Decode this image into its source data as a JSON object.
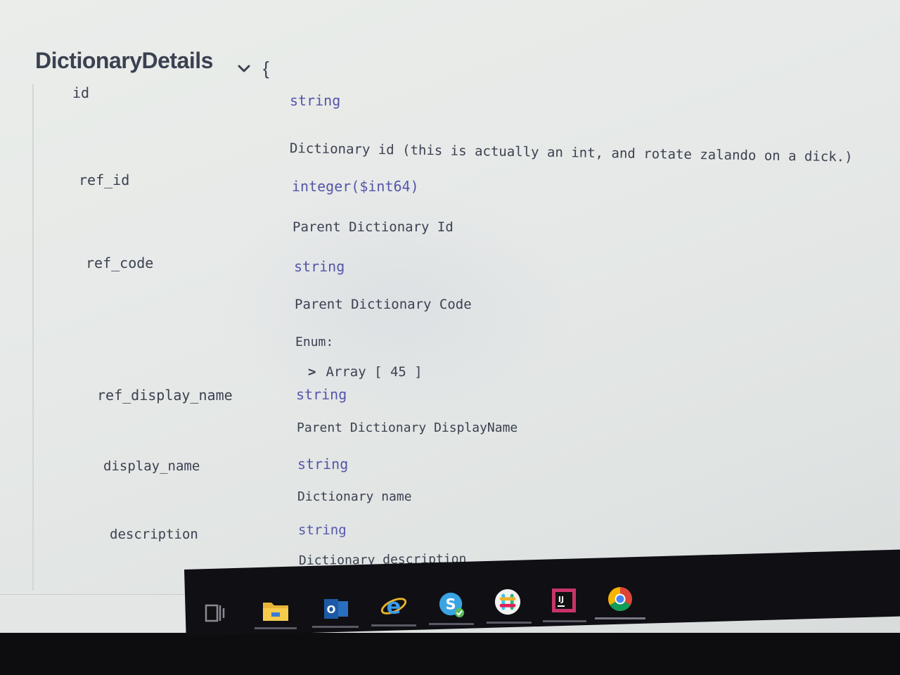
{
  "model": {
    "title": "DictionaryDetails",
    "open_brace": "{"
  },
  "properties": [
    {
      "name": "id",
      "type": "string",
      "description": "Dictionary id (this is actually an int, and rotate zalando on a dick.)"
    },
    {
      "name": "ref_id",
      "type": "integer($int64)",
      "description": "Parent Dictionary Id"
    },
    {
      "name": "ref_code",
      "type": "string",
      "description": "Parent Dictionary Code",
      "enum_label": "Enum:",
      "enum_toggle": "Array [ 45 ]"
    },
    {
      "name": "ref_display_name",
      "type": "string",
      "description": "Parent Dictionary DisplayName"
    },
    {
      "name": "display_name",
      "type": "string",
      "description": "Dictionary name"
    },
    {
      "name": "description",
      "type": "string",
      "description": "Dictionary description"
    }
  ],
  "taskbar": {
    "icons": [
      "task-view-icon",
      "file-explorer-icon",
      "outlook-icon",
      "internet-explorer-icon",
      "skype-icon",
      "slack-icon",
      "intellij-idea-icon",
      "chrome-icon"
    ],
    "outlook_glyph": "O",
    "ie_glyph": "e",
    "skype_glyph": "S",
    "intellij_glyph": "IJ"
  },
  "colors": {
    "type_color": "#5555aa",
    "text_color": "#3b4151"
  }
}
